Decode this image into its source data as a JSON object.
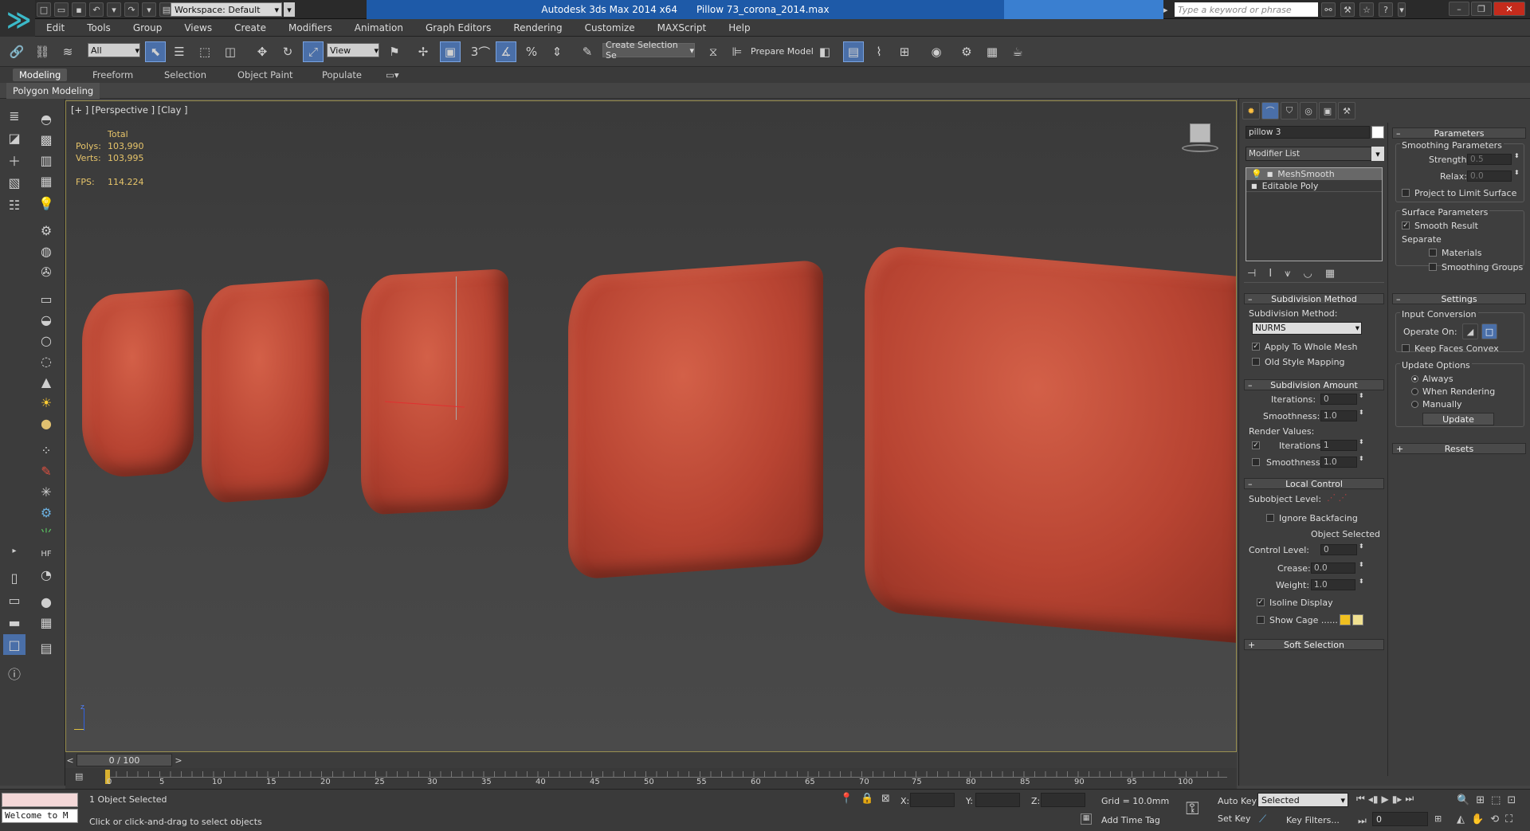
{
  "app": {
    "window_title": "Autodesk 3ds Max  2014 x64",
    "file_title": "Pillow 73_corona_2014.max",
    "workspace": "Workspace: Default",
    "search_placeholder": "Type a keyword or phrase"
  },
  "menu": [
    "Edit",
    "Tools",
    "Group",
    "Views",
    "Create",
    "Modifiers",
    "Animation",
    "Graph Editors",
    "Rendering",
    "Customize",
    "MAXScript",
    "Help"
  ],
  "toolbar": {
    "selection_filter": "All",
    "ref_coord": "View",
    "named_selection": "Create Selection Se",
    "prepare_model": "Prepare Model",
    "snap_toggle": "3",
    "angle_snap": "",
    "percent_snap": "%"
  },
  "ribbon": {
    "tabs": [
      "Modeling",
      "Freeform",
      "Selection",
      "Object Paint",
      "Populate"
    ],
    "active_tab": "Modeling",
    "panel": "Polygon Modeling"
  },
  "viewport": {
    "label": "[+ ] [Perspective ] [Clay ]",
    "stats_header": "Total",
    "polys_label": "Polys:",
    "polys_value": "103,990",
    "verts_label": "Verts:",
    "verts_value": "103,995",
    "fps_label": "FPS:",
    "fps_value": "114.224",
    "pillow_color": "#c04c38"
  },
  "modifier_panel": {
    "object_name": "pillow 3",
    "modifier_list": "Modifier List",
    "stack": [
      "MeshSmooth",
      "Editable Poly"
    ],
    "subdivision_method_title": "Subdivision Method",
    "subdivision_method_label": "Subdivision Method:",
    "subdivision_method_value": "NURMS",
    "apply_whole_mesh": "Apply To Whole Mesh",
    "old_style_mapping": "Old Style Mapping",
    "subdivision_amount_title": "Subdivision Amount",
    "iterations_label": "Iterations:",
    "iterations_value": "0",
    "smoothness_label": "Smoothness:",
    "smoothness_value": "1.0",
    "render_values": "Render Values:",
    "render_iterations_label": "Iterations:",
    "render_iterations_value": "1",
    "render_smoothness_label": "Smoothness:",
    "render_smoothness_value": "1.0",
    "local_control_title": "Local Control",
    "subobject_level": "Subobject Level:",
    "ignore_backfacing": "Ignore Backfacing",
    "object_selected": "Object Selected",
    "control_level_label": "Control Level:",
    "control_level_value": "0",
    "crease_label": "Crease:",
    "crease_value": "0.0",
    "weight_label": "Weight:",
    "weight_value": "1.0",
    "isoline_display": "Isoline Display",
    "show_cage": "Show Cage ......",
    "soft_selection_title": "Soft Selection"
  },
  "parameters_panel": {
    "title": "Parameters",
    "smoothing_params": "Smoothing Parameters",
    "strength_label": "Strength:",
    "strength_value": "0.5",
    "relax_label": "Relax:",
    "relax_value": "0.0",
    "project_limit": "Project to Limit Surface",
    "surface_params": "Surface Parameters",
    "smooth_result": "Smooth Result",
    "separate": "Separate",
    "materials": "Materials",
    "smoothing_groups": "Smoothing Groups",
    "settings_title": "Settings",
    "input_conversion": "Input Conversion",
    "operate_on": "Operate On:",
    "keep_faces_convex": "Keep Faces Convex",
    "update_options": "Update Options",
    "always": "Always",
    "when_rendering": "When Rendering",
    "manually": "Manually",
    "update_button": "Update",
    "resets_title": "Resets"
  },
  "timeline": {
    "frame_counter": "0 / 100",
    "ticks": [
      "0",
      "5",
      "10",
      "15",
      "20",
      "25",
      "30",
      "35",
      "40",
      "45",
      "50",
      "55",
      "60",
      "65",
      "70",
      "75",
      "80",
      "85",
      "90",
      "95",
      "100"
    ]
  },
  "status": {
    "maxscript": "Welcome to M",
    "selection": "1 Object Selected",
    "prompt": "Click or click-and-drag to select objects",
    "x_label": "X:",
    "y_label": "Y:",
    "z_label": "Z:",
    "grid": "Grid = 10.0mm",
    "add_time_tag": "Add Time Tag",
    "auto_key": "Auto Key",
    "set_key": "Set Key",
    "key_selected": "Selected",
    "key_filters": "Key Filters...",
    "frame_value": "0"
  }
}
